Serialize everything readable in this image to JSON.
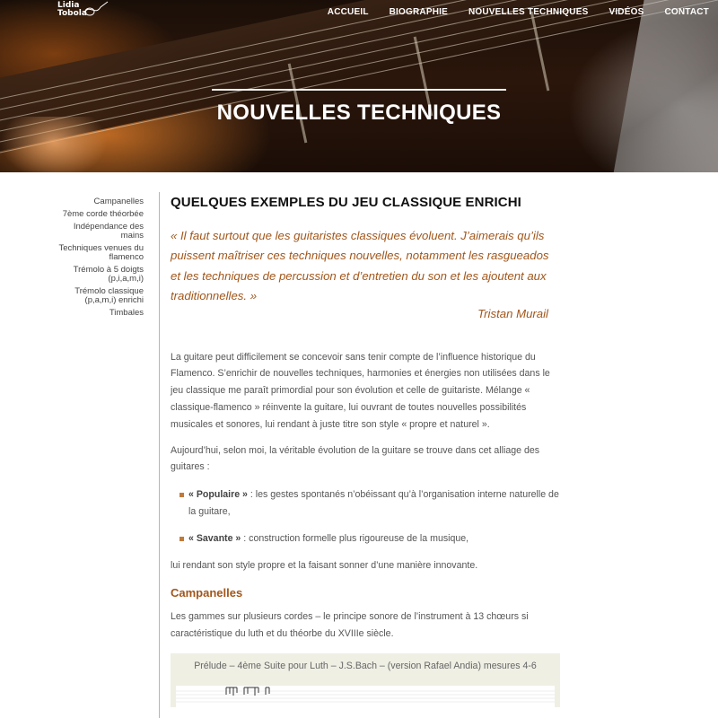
{
  "header": {
    "logo": {
      "line1": "Lidia",
      "line2": "Tobola"
    },
    "nav": [
      "ACCUEIL",
      "BIOGRAPHIE",
      "NOUVELLES TECHNIQUES",
      "VIDÉOS",
      "CONTACT"
    ],
    "hero_title": "NOUVELLES TECHNIQUES"
  },
  "sidebar": {
    "items": [
      {
        "label": "Campanelles"
      },
      {
        "label": "7ème corde théorbée"
      },
      {
        "label": "Indépendance des mains"
      },
      {
        "label": "Techniques venues du flamenco"
      },
      {
        "label": "Trémolo à 5 doigts (p,i,a,m,i)"
      },
      {
        "label": "Trémolo classique (p,a,m,i) enrichi"
      },
      {
        "label": "Timbales"
      }
    ]
  },
  "main": {
    "title": "QUELQUES EXEMPLES DU JEU CLASSIQUE ENRICHI",
    "quote": "« Il faut surtout que les guitaristes classiques évoluent. J’aimerais qu’ils puissent maîtriser ces techniques nouvelles, notamment les rasgueados et les techniques de percussion et d’entretien du son et les ajoutent aux traditionnelles. »",
    "quote_author": "Tristan Murail",
    "paragraph1": "La guitare peut difficilement se concevoir sans tenir compte de l’influence historique du Flamenco. S’enrichir de nouvelles techniques, harmonies et énergies non utilisées dans le jeu classique me paraît primordial pour son évolution et celle de guitariste. Mélange « classique-flamenco » réinvente la guitare, lui ouvrant  de toutes nouvelles possibilités musicales et sonores, lui rendant à juste titre son style « propre et naturel ».",
    "paragraph2": "Aujourd’hui, selon moi, la véritable évolution de la guitare se trouve dans cet alliage des guitares :",
    "bullets": [
      {
        "term": "« Populaire »",
        "text": " : les gestes spontanés n’obéissant qu’à l’organisation interne naturelle de la guitare,"
      },
      {
        "term": "« Savante »",
        "text": " : construction formelle plus rigoureuse de la musique,"
      }
    ],
    "paragraph3": "lui rendant son style propre et la faisant sonner d’une manière innovante.",
    "section_title": "Campanelles",
    "paragraph4": "Les gammes sur plusieurs cordes – le principe sonore de l’instrument à 13 chœurs si caractéristique du luth et du théorbe du XVIIIe siècle.",
    "figure_caption": "Prélude – 4ème Suite pour Luth – J.S.Bach – (version Rafael Andia) mesures 4-6"
  },
  "colors": {
    "accent": "#a2561a",
    "bullet": "#c07a3a",
    "caption_bg": "#efefe4"
  }
}
